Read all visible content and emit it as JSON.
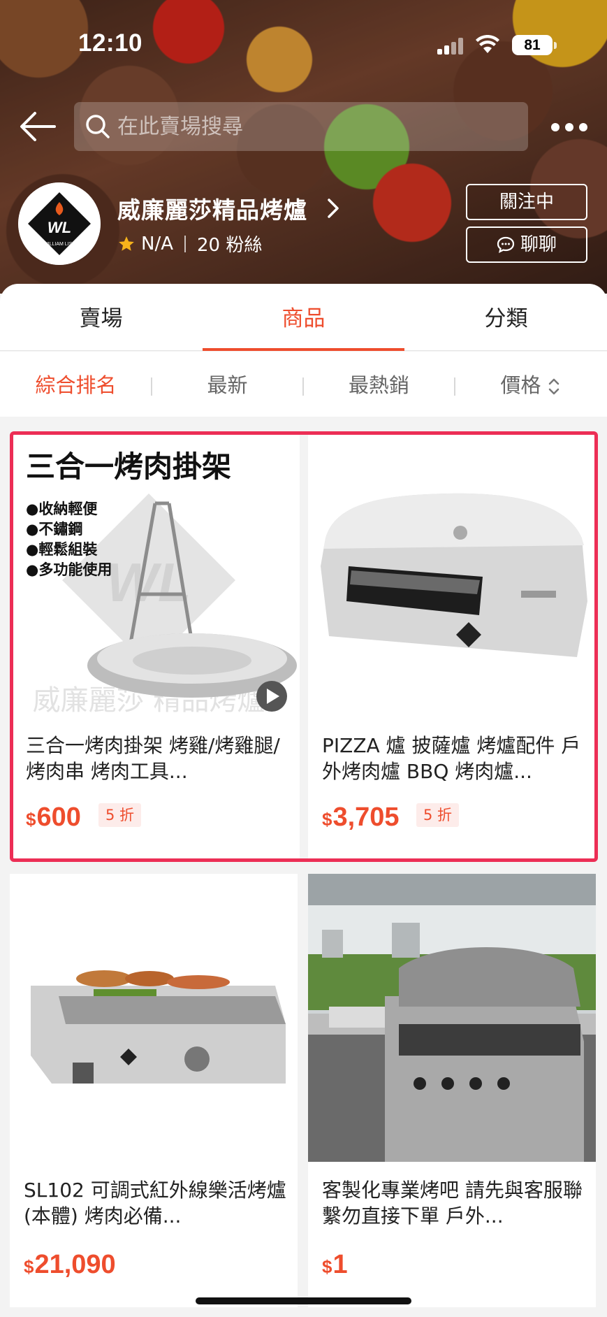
{
  "status_bar": {
    "time": "12:10",
    "battery": "81"
  },
  "search": {
    "placeholder": "在此賣場搜尋"
  },
  "shop": {
    "name": "威廉麗莎精品烤爐",
    "rating": "N/A",
    "followers": "20 粉絲",
    "logo_text": "WILLIAM LISA",
    "follow_label": "關注中",
    "chat_label": "聊聊"
  },
  "tabs": [
    {
      "label": "賣場"
    },
    {
      "label": "商品",
      "active": true
    },
    {
      "label": "分類"
    }
  ],
  "sort": [
    {
      "label": "綜合排名",
      "active": true
    },
    {
      "label": "最新"
    },
    {
      "label": "最熱銷"
    },
    {
      "label": "價格"
    }
  ],
  "products": [
    {
      "title": "三合一烤肉掛架 烤雞/烤雞腿/烤肉串 烤肉工具...",
      "currency": "$",
      "price": "600",
      "discount": "5 折",
      "image": {
        "heading": "三合一烤肉掛架",
        "bullets": [
          "●收納輕便",
          "●不鏽鋼",
          "●輕鬆組裝",
          "●多功能使用"
        ],
        "watermark": "威廉麗莎 精品烤爐",
        "has_video": true
      }
    },
    {
      "title": "PIZZA 爐 披薩爐 烤爐配件 戶外烤肉爐 BBQ 烤肉爐...",
      "currency": "$",
      "price": "3,705",
      "discount": "5 折"
    },
    {
      "title": "SL102 可調式紅外線樂活烤爐 (本體) 烤肉必備...",
      "currency": "$",
      "price": "21,090"
    },
    {
      "title": "客製化專業烤吧 請先與客服聯繫勿直接下單 戶外...",
      "currency": "$",
      "price": "1"
    }
  ],
  "colors": {
    "accent": "#ee4d2d",
    "highlight": "#ec2e55"
  }
}
